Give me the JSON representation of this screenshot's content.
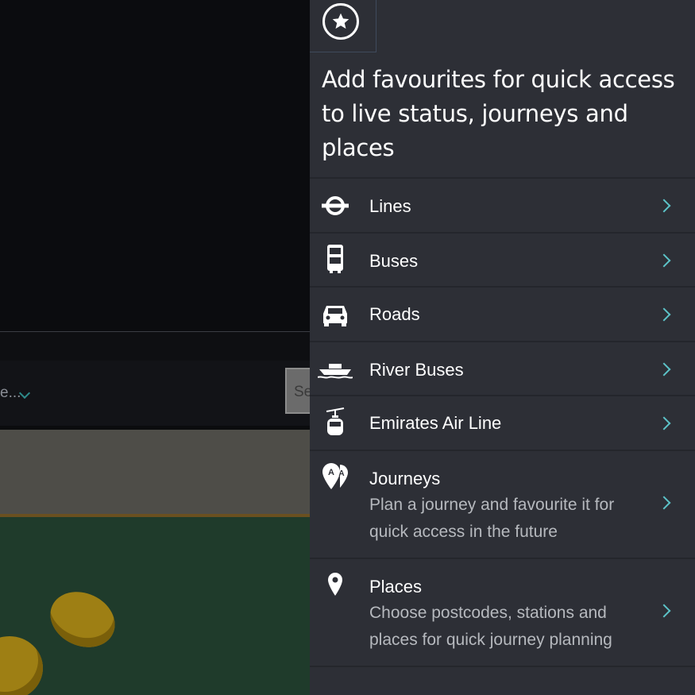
{
  "background": {
    "filter_text": "e...",
    "search_text": "Se"
  },
  "panel": {
    "title": "Add favourites for quick access to live status, journeys and places",
    "accent_color": "#5cc3c8",
    "items": [
      {
        "label": "Lines",
        "icon": "roundel-icon"
      },
      {
        "label": "Buses",
        "icon": "bus-icon"
      },
      {
        "label": "Roads",
        "icon": "car-icon"
      },
      {
        "label": "River Buses",
        "icon": "boat-icon"
      },
      {
        "label": "Emirates Air Line",
        "icon": "cable-car-icon"
      },
      {
        "label": "Journeys",
        "icon": "journey-pins-icon",
        "description": "Plan a journey and favourite it for quick access in the future"
      },
      {
        "label": "Places",
        "icon": "location-pin-icon",
        "description": "Choose postcodes, stations and places for quick journey planning"
      }
    ]
  }
}
